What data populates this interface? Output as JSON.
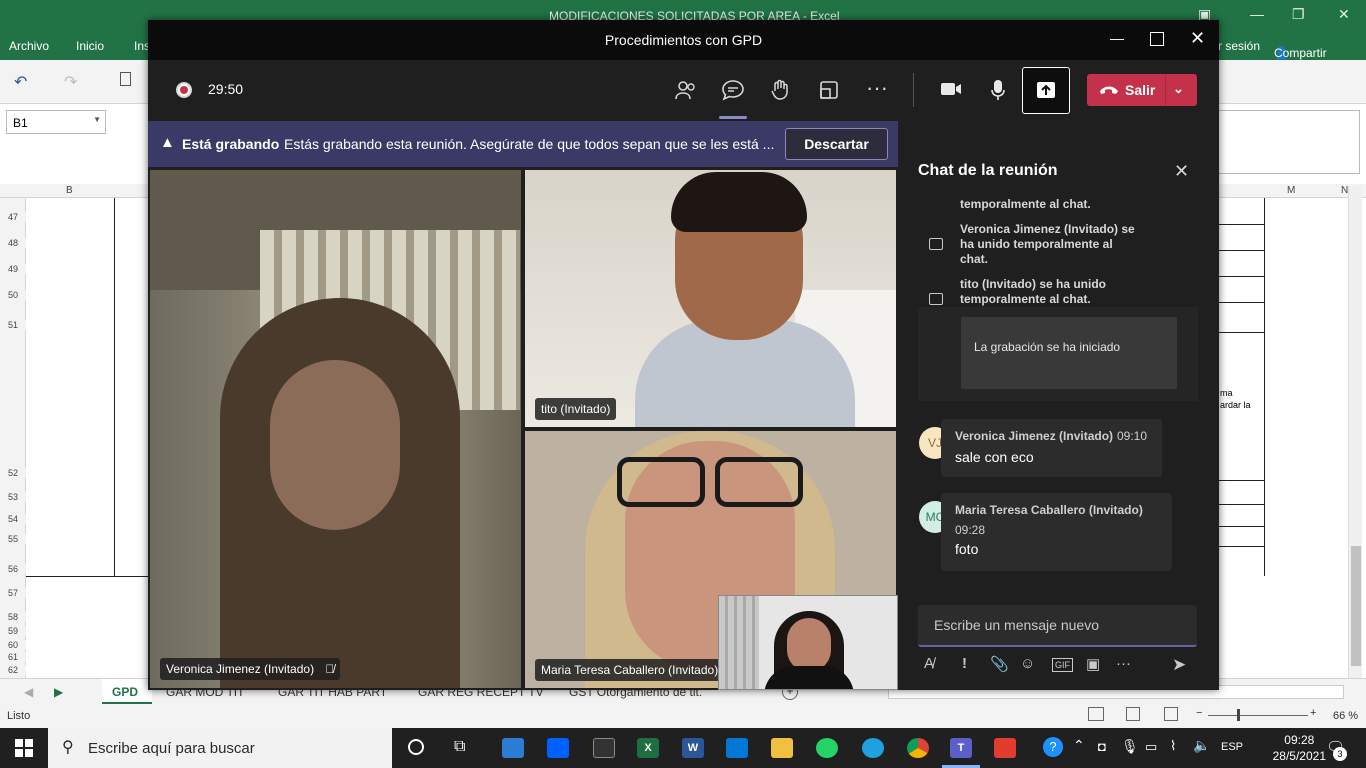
{
  "excel": {
    "title": "MODIFICACIONES SOLICITADAS POR AREA - Excel",
    "ribbon_tabs": [
      "Archivo",
      "Inicio",
      "Ins"
    ],
    "sign_in": "r sesión",
    "share": "Compartir",
    "name_box": "B1",
    "col_b": "B",
    "col_m": "M",
    "col_n": "N",
    "rows": [
      "47",
      "48",
      "49",
      "50",
      "51",
      "52",
      "53",
      "54",
      "55",
      "56",
      "57",
      "58",
      "59",
      "60",
      "61",
      "62"
    ],
    "cell_snippets": [
      "ma",
      "ardar la"
    ],
    "sheet_tabs": [
      "GPD",
      "GAR MOD TIT",
      "GAR TIT HAB PART",
      "GAR REG RECEPT TV",
      "GST Otorgamiento de tit."
    ],
    "status_left": "Listo",
    "zoom": "66 %"
  },
  "teams": {
    "window_title": "Procedimientos con GPD",
    "timer": "29:50",
    "leave_label": "Salir",
    "banner": {
      "title": "Está grabando",
      "text": "Estás grabando esta reunión. Asegúrate de que todos sepan que se les está ...",
      "dismiss": "Descartar"
    },
    "participants": [
      {
        "name": "Veronica Jimenez (Invitado)"
      },
      {
        "name": "tito (Invitado)"
      },
      {
        "name": "Maria Teresa Caballero (Invitado)"
      }
    ],
    "chat": {
      "title": "Chat de la reunión",
      "system_messages": [
        "temporalmente al chat.",
        "Veronica Jimenez (Invitado) se ha unido temporalmente al chat.",
        "tito (Invitado) se ha unido temporalmente al chat."
      ],
      "recording_notice": "La grabación se ha iniciado",
      "messages": [
        {
          "initials": "VJ",
          "author": "Veronica Jimenez (Invitado)",
          "time": "09:10",
          "text": "sale con eco",
          "avatar_color": "#f8e6c2"
        },
        {
          "initials": "MC",
          "author": "Maria Teresa Caballero (Invitado)",
          "time": "09:28",
          "text": "foto",
          "avatar_color": "#d2ede4"
        }
      ],
      "composer_placeholder": "Escribe un mensaje nuevo"
    }
  },
  "taskbar": {
    "search_placeholder": "Escribe aquí para buscar",
    "language": "ESP",
    "time": "09:28",
    "date": "28/5/2021",
    "notifications": "3"
  }
}
